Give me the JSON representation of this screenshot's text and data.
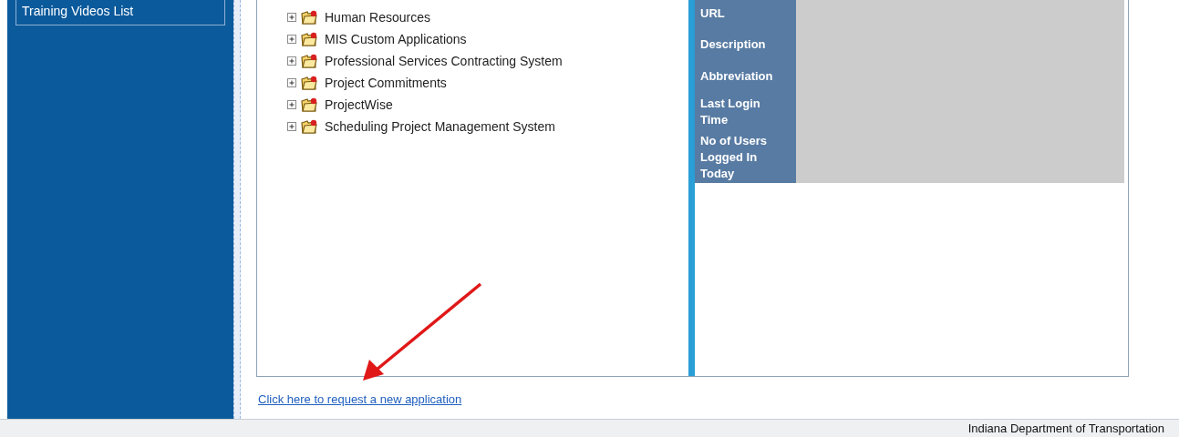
{
  "sidebar": {
    "items": [
      {
        "label": "Training Videos List"
      }
    ]
  },
  "tree": {
    "items": [
      {
        "label": "Human Resources",
        "expanded": false
      },
      {
        "label": "MIS Custom Applications",
        "expanded": false
      },
      {
        "label": "Professional Services Contracting System",
        "expanded": false
      },
      {
        "label": "Project Commitments",
        "expanded": false
      },
      {
        "label": "ProjectWise",
        "expanded": false
      },
      {
        "label": "Scheduling Project Management System",
        "expanded": false
      }
    ]
  },
  "details": {
    "fields": [
      "URL",
      "Description",
      "Abbreviation",
      "Last Login Time",
      "No of Users Logged In Today"
    ]
  },
  "request_link": "Click here to request a new application",
  "footer": {
    "text": "Indiana Department of Transportation"
  }
}
